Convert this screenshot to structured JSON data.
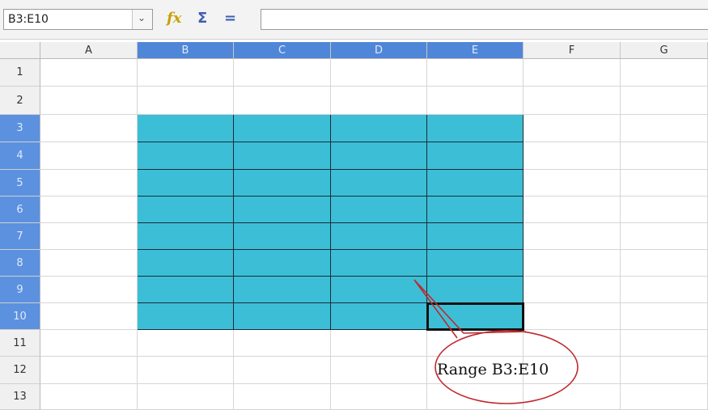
{
  "formula_bar": {
    "name_box_value": "B3:E10",
    "formula_value": "",
    "icons": [
      "chevron-down-icon",
      "function-wizard-icon",
      "sum-icon",
      "equals-icon"
    ]
  },
  "sheet": {
    "columns": [
      "A",
      "B",
      "C",
      "D",
      "E",
      "F",
      "G"
    ],
    "rows": [
      "1",
      "2",
      "3",
      "4",
      "5",
      "6",
      "7",
      "8",
      "9",
      "10",
      "11",
      "12",
      "13"
    ],
    "selected_columns": [
      "B",
      "C",
      "D",
      "E"
    ],
    "selected_rows": [
      "3",
      "4",
      "5",
      "6",
      "7",
      "8",
      "9",
      "10"
    ],
    "active_cell": "E10",
    "selection_color": "#3cbfd6",
    "header_highlight_color": "#4f86d8"
  },
  "annotation": {
    "label": "Range B3:E10",
    "outline_color": "#c0282d"
  }
}
